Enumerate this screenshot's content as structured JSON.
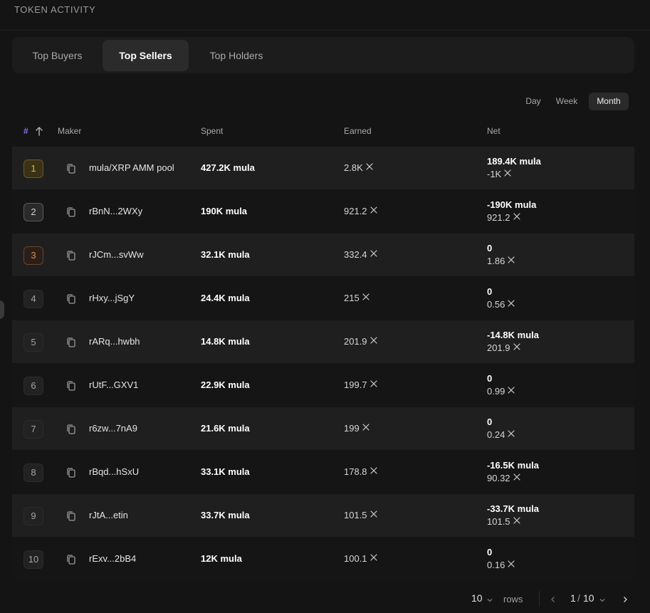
{
  "header": {
    "title": "TOKEN ACTIVITY"
  },
  "tabs": [
    {
      "label": "Top Buyers",
      "active": false
    },
    {
      "label": "Top Sellers",
      "active": true
    },
    {
      "label": "Top Holders",
      "active": false
    }
  ],
  "periods": [
    {
      "label": "Day",
      "active": false
    },
    {
      "label": "Week",
      "active": false
    },
    {
      "label": "Month",
      "active": true
    }
  ],
  "table": {
    "columns": {
      "rank": "#",
      "maker": "Maker",
      "spent": "Spent",
      "earned": "Earned",
      "net": "Net"
    },
    "rows": [
      {
        "rank": "1",
        "maker": "mula/XRP AMM pool",
        "spent": "427.2K mula",
        "earned": "2.8K",
        "net_token": "189.4K mula",
        "net_xrp": "-1K"
      },
      {
        "rank": "2",
        "maker": "rBnN...2WXy",
        "spent": "190K mula",
        "earned": "921.2",
        "net_token": "-190K mula",
        "net_xrp": "921.2"
      },
      {
        "rank": "3",
        "maker": "rJCm...svWw",
        "spent": "32.1K mula",
        "earned": "332.4",
        "net_token": "0",
        "net_xrp": "1.86"
      },
      {
        "rank": "4",
        "maker": "rHxy...jSgY",
        "spent": "24.4K mula",
        "earned": "215",
        "net_token": "0",
        "net_xrp": "0.56"
      },
      {
        "rank": "5",
        "maker": "rARq...hwbh",
        "spent": "14.8K mula",
        "earned": "201.9",
        "net_token": "-14.8K mula",
        "net_xrp": "201.9"
      },
      {
        "rank": "6",
        "maker": "rUtF...GXV1",
        "spent": "22.9K mula",
        "earned": "199.7",
        "net_token": "0",
        "net_xrp": "0.99"
      },
      {
        "rank": "7",
        "maker": "r6zw...7nA9",
        "spent": "21.6K mula",
        "earned": "199",
        "net_token": "0",
        "net_xrp": "0.24"
      },
      {
        "rank": "8",
        "maker": "rBqd...hSxU",
        "spent": "33.1K mula",
        "earned": "178.8",
        "net_token": "-16.5K mula",
        "net_xrp": "90.32"
      },
      {
        "rank": "9",
        "maker": "rJtA...etin",
        "spent": "33.7K mula",
        "earned": "101.5",
        "net_token": "-33.7K mula",
        "net_xrp": "101.5"
      },
      {
        "rank": "10",
        "maker": "rExv...2bB4",
        "spent": "12K mula",
        "earned": "100.1",
        "net_token": "0",
        "net_xrp": "0.16"
      }
    ]
  },
  "pagination": {
    "page_size": "10",
    "rows_label": "rows",
    "page": "1",
    "total_pages": "10"
  },
  "icons": {
    "sort": "arrow-up-icon",
    "copy": "copy-icon",
    "currency": "xrp-icon",
    "prev": "chevron-left-icon",
    "next": "chevron-right-icon",
    "dropdown": "chevron-down-icon"
  },
  "colors": {
    "background": "#141414",
    "accent": "#8e6cf5",
    "gold": "#e0b43a",
    "bronze": "#e08a4a"
  }
}
